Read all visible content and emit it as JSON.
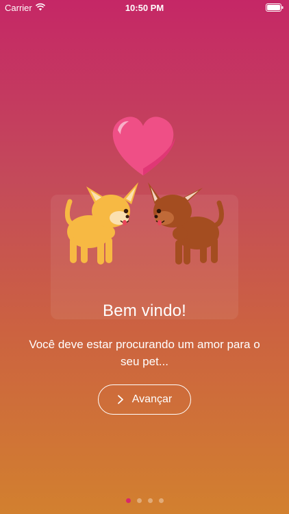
{
  "status_bar": {
    "carrier": "Carrier",
    "time": "10:50 PM",
    "wifi_icon": "wifi-icon",
    "battery_icon": "battery-icon"
  },
  "onboarding": {
    "title": "Bem vindo!",
    "subtitle": "Você deve estar procurando um amor para o seu pet...",
    "next_button_label": "Avançar",
    "next_button_icon": "chevron-right-icon",
    "illustration": "two-dogs-with-heart",
    "pages": [
      {
        "page": 1,
        "active": true
      },
      {
        "page": 2,
        "active": false
      },
      {
        "page": 3,
        "active": false
      },
      {
        "page": 4,
        "active": false
      }
    ]
  },
  "colors": {
    "gradient_top": "#c52766",
    "gradient_bottom": "#d2802f",
    "heart": "#ef4f86",
    "dog_light": "#f7b943",
    "dog_dark": "#a44d20",
    "active_dot": "#d8286a"
  }
}
